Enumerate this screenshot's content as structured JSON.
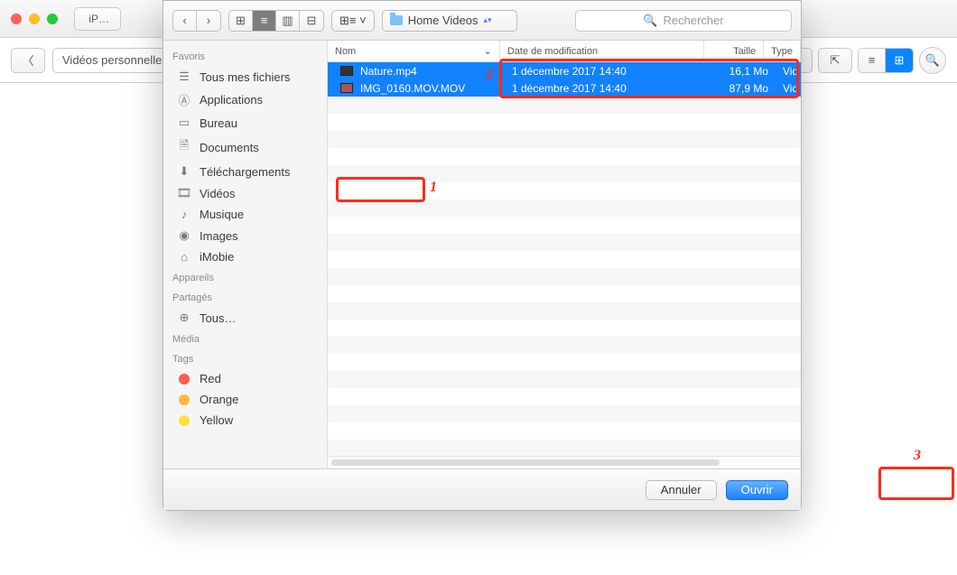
{
  "bg": {
    "device_label": "iP…",
    "back_chevron": "〈",
    "breadcrumb": "Vidéos personnelles"
  },
  "dialog": {
    "nav": {
      "back": "‹",
      "fwd": "›"
    },
    "views": {
      "icon": "⊞",
      "list": "≡",
      "col": "▥",
      "gallery": "⊟"
    },
    "arrange": "⊞≡ ˅",
    "location": "Home Videos",
    "search_placeholder": "Rechercher"
  },
  "sidebar": {
    "sections": [
      {
        "title": "Favoris",
        "items": [
          {
            "icon": "☰",
            "label": "Tous mes fichiers"
          },
          {
            "icon": "Ⓐ",
            "label": "Applications"
          },
          {
            "icon": "▭",
            "label": "Bureau"
          },
          {
            "icon": "🗎",
            "label": "Documents"
          },
          {
            "icon": "⬇",
            "label": "Téléchargements"
          },
          {
            "icon": "🎞",
            "label": "Vidéos",
            "selected": true
          },
          {
            "icon": "♪",
            "label": "Musique"
          },
          {
            "icon": "◉",
            "label": "Images"
          },
          {
            "icon": "⌂",
            "label": "iMobie"
          }
        ]
      },
      {
        "title": "Appareils",
        "items": []
      },
      {
        "title": "Partagés",
        "items": [
          {
            "icon": "⊕",
            "label": "Tous…"
          }
        ]
      },
      {
        "title": "Média",
        "items": []
      },
      {
        "title": "Tags",
        "items": [
          {
            "tag": "#ff5b4f",
            "label": "Red"
          },
          {
            "tag": "#ffba3b",
            "label": "Orange"
          },
          {
            "tag": "#ffe13b",
            "label": "Yellow"
          }
        ]
      }
    ]
  },
  "columns": {
    "name": "Nom",
    "date": "Date de modification",
    "size": "Taille",
    "type": "Type"
  },
  "files": [
    {
      "name": "Nature.mp4",
      "date": "1 décembre 2017 14:40",
      "size": "16,1 Mo",
      "type": "Vid"
    },
    {
      "name": "IMG_0160.MOV.MOV",
      "date": "1 décembre 2017 14:40",
      "size": "87,9 Mo",
      "type": "Vid"
    }
  ],
  "footer": {
    "cancel": "Annuler",
    "open": "Ouvrir"
  },
  "icons": {
    "search": "🔍",
    "import": "⇲",
    "export": "⇱",
    "list": "≡",
    "grid": "⊞",
    "chevdown": "⌄",
    "updown": "▴▾"
  }
}
